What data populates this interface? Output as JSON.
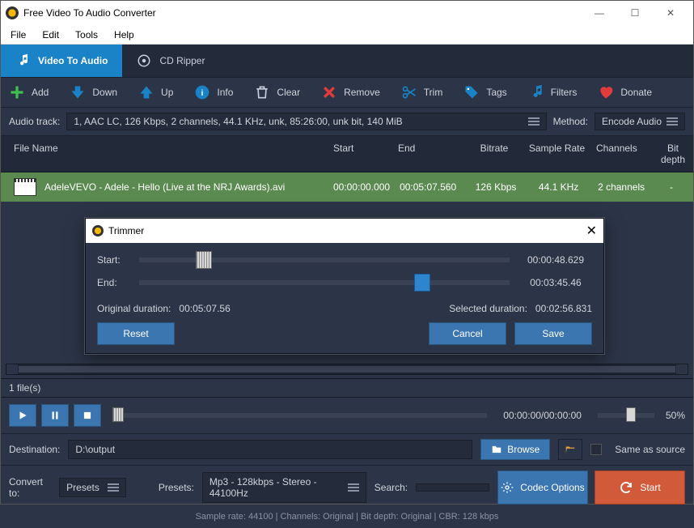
{
  "window": {
    "title": "Free Video To Audio Converter"
  },
  "menu": {
    "file": "File",
    "edit": "Edit",
    "tools": "Tools",
    "help": "Help"
  },
  "tabs": {
    "video": "Video To Audio",
    "cd": "CD Ripper"
  },
  "toolbar": {
    "add": "Add",
    "down": "Down",
    "up": "Up",
    "info": "Info",
    "clear": "Clear",
    "remove": "Remove",
    "trim": "Trim",
    "tags": "Tags",
    "filters": "Filters",
    "donate": "Donate"
  },
  "audiotrack": {
    "label": "Audio track:",
    "value": "1, AAC LC, 126 Kbps, 2 channels, 44.1 KHz, unk, 85:26:00, unk bit, 140 MiB",
    "method_label": "Method:",
    "method_value": "Encode Audio"
  },
  "columns": {
    "name": "File Name",
    "start": "Start",
    "end": "End",
    "bitrate": "Bitrate",
    "samplerate": "Sample Rate",
    "channels": "Channels",
    "bitdepth": "Bit depth"
  },
  "rows": [
    {
      "name": "AdeleVEVO - Adele - Hello (Live at the NRJ Awards).avi",
      "start": "00:00:00.000",
      "end": "00:05:07.560",
      "bitrate": "126 Kbps",
      "samplerate": "44.1 KHz",
      "channels": "2 channels",
      "bitdepth": "-"
    }
  ],
  "status": {
    "count": "1 file(s)",
    "time": "00:00:00/00:00:00",
    "percent": "50%"
  },
  "dest": {
    "label": "Destination:",
    "value": "D:\\output",
    "browse": "Browse",
    "same": "Same as source"
  },
  "convert": {
    "label": "Convert to:",
    "preset_sel": "Presets",
    "presets_label": "Presets:",
    "preset_value": "Mp3 - 128kbps - Stereo - 44100Hz",
    "search_label": "Search:",
    "codec": "Codec Options",
    "start": "Start"
  },
  "footer": {
    "text": "Sample rate: 44100 | Channels: Original | Bit depth: Original | CBR: 128 kbps"
  },
  "dialog": {
    "title": "Trimmer",
    "start_label": "Start:",
    "start_value": "00:00:48.629",
    "end_label": "End:",
    "end_value": "00:03:45.46",
    "orig_label": "Original duration:",
    "orig_value": "00:05:07.56",
    "sel_label": "Selected duration:",
    "sel_value": "00:02:56.831",
    "reset": "Reset",
    "cancel": "Cancel",
    "save": "Save"
  }
}
